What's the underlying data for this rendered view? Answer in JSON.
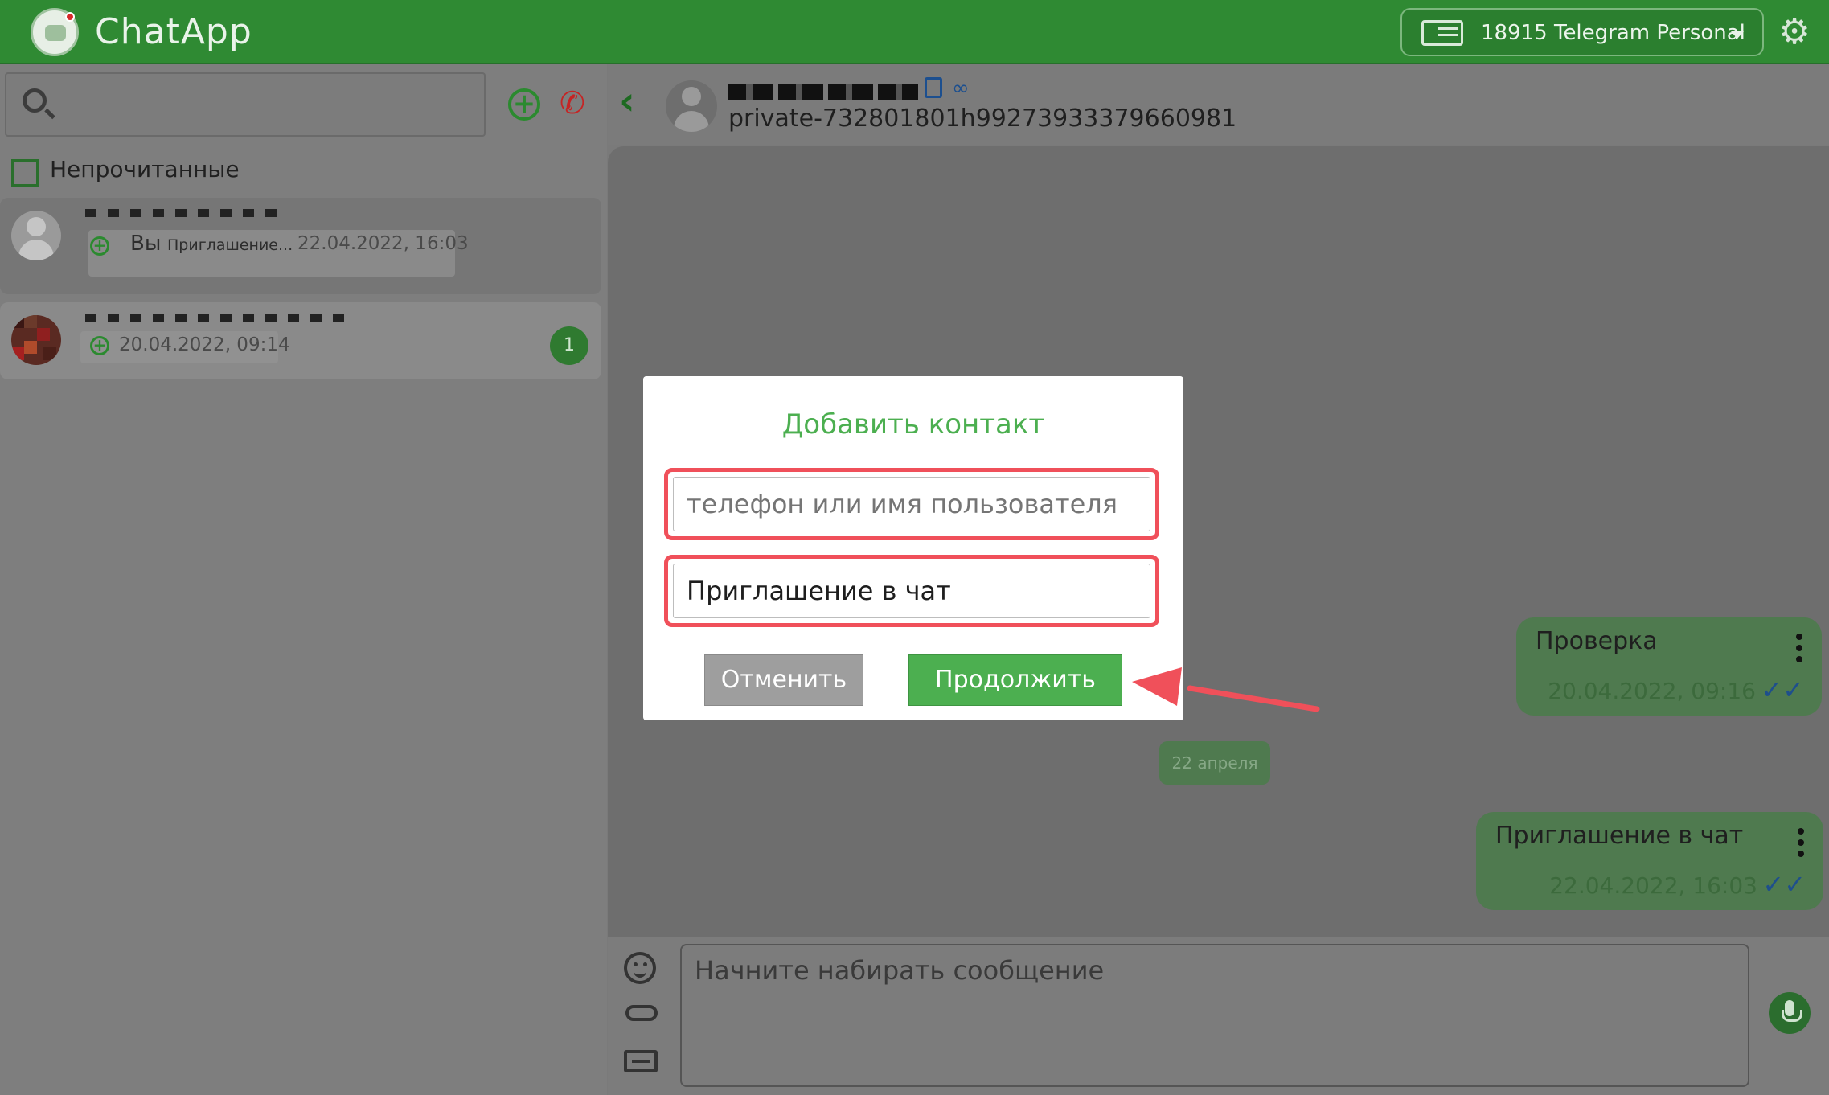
{
  "topbar": {
    "app_title": "ChatApp",
    "account_label": "18915 Telegram Personal"
  },
  "sidebar": {
    "search_placeholder": "",
    "unread_label": "Непрочитанные",
    "chats": [
      {
        "preview_sender": "Вы",
        "preview_text": "Приглашение...",
        "time": "22.04.2022, 16:03"
      },
      {
        "time": "20.04.2022, 09:14",
        "unread_count": "1"
      }
    ]
  },
  "chat": {
    "id_line": "private-732801801h99273933379660981",
    "messages": [
      {
        "text": "Проверка",
        "time": "20.04.2022, 09:16"
      },
      {
        "text": "Приглашение в чат",
        "time": "22.04.2022, 16:03"
      }
    ],
    "date_divider": "22 апреля",
    "composer_placeholder": "Начните набирать сообщение"
  },
  "modal": {
    "title": "Добавить контакт",
    "contact_placeholder": "телефон или имя пользователя",
    "message_value": "Приглашение в чат",
    "cancel_label": "Отменить",
    "continue_label": "Продолжить"
  },
  "colors": {
    "brand_green": "#2f8a33",
    "button_green": "#4caf50",
    "highlight_red": "#f0505a"
  }
}
